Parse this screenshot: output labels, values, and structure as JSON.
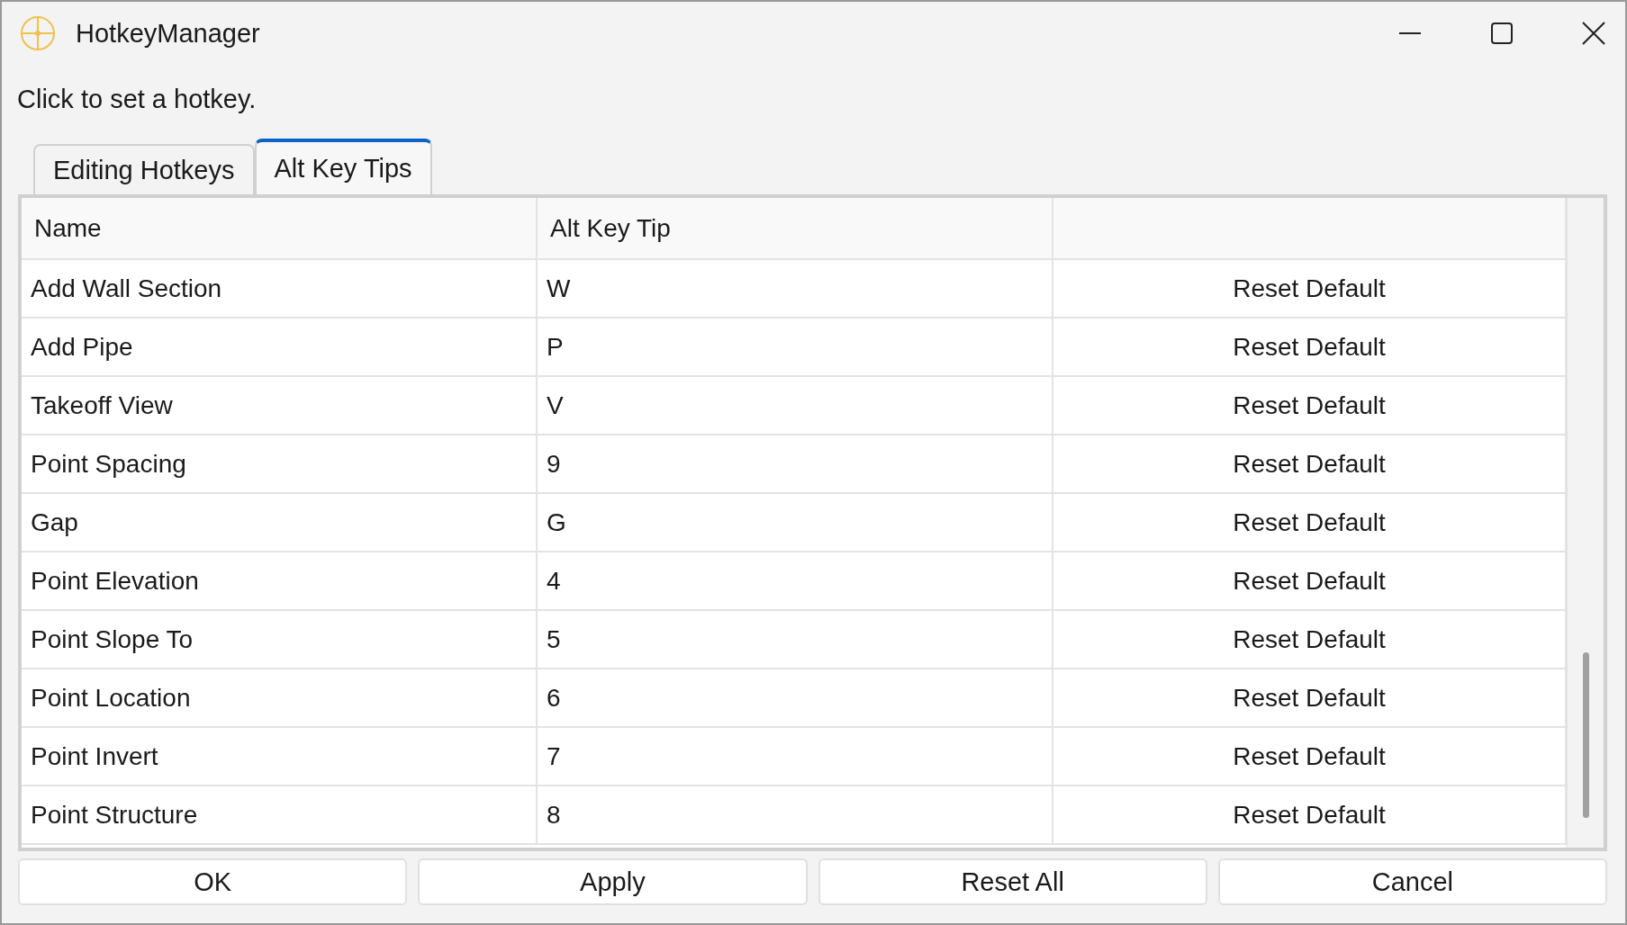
{
  "window": {
    "title": "HotkeyManager"
  },
  "instruction": "Click to set a hotkey.",
  "tabs": [
    {
      "label": "Editing Hotkeys",
      "selected": false
    },
    {
      "label": "Alt Key Tips",
      "selected": true
    }
  ],
  "table": {
    "columns": [
      "Name",
      "Alt Key Tip"
    ],
    "rows": [
      {
        "name": "Add Wall Section",
        "key": "W",
        "action": "Reset Default"
      },
      {
        "name": "Add Pipe",
        "key": "P",
        "action": "Reset Default"
      },
      {
        "name": "Takeoff View",
        "key": "V",
        "action": "Reset Default"
      },
      {
        "name": "Point Spacing",
        "key": "9",
        "action": "Reset Default"
      },
      {
        "name": "Gap",
        "key": "G",
        "action": "Reset Default"
      },
      {
        "name": "Point Elevation",
        "key": "4",
        "action": "Reset Default"
      },
      {
        "name": "Point Slope To",
        "key": "5",
        "action": "Reset Default"
      },
      {
        "name": "Point Location",
        "key": "6",
        "action": "Reset Default"
      },
      {
        "name": "Point Invert",
        "key": "7",
        "action": "Reset Default"
      },
      {
        "name": "Point Structure",
        "key": "8",
        "action": "Reset Default"
      }
    ]
  },
  "buttons": [
    "OK",
    "Apply",
    "Reset All",
    "Cancel"
  ]
}
